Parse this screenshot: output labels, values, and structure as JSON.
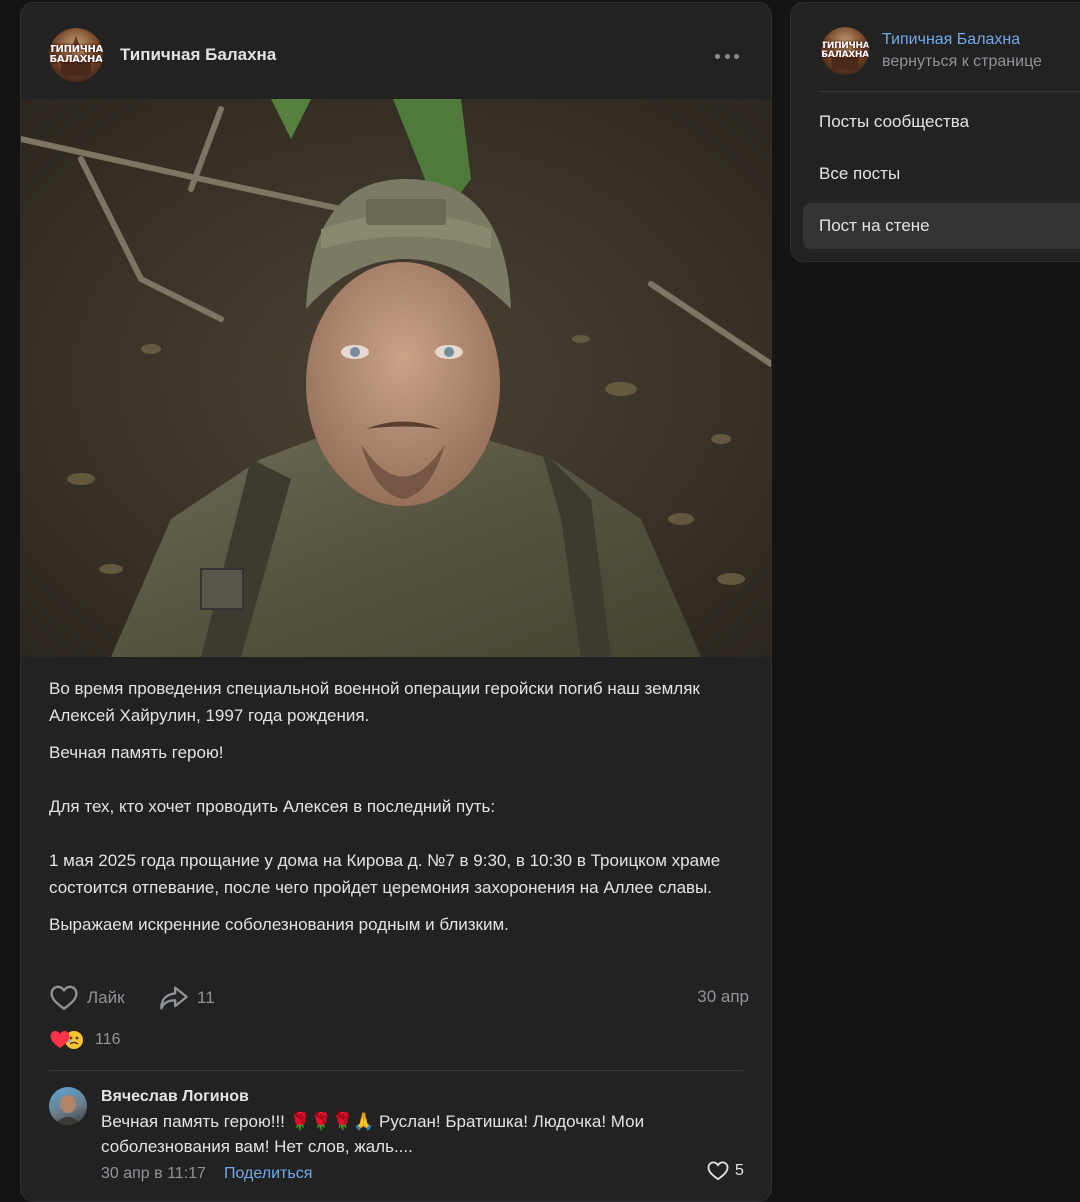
{
  "post": {
    "author": "Типичная Балахна",
    "avatar_text_line1": "ТИПИЧНАЯ",
    "avatar_text_line2": "БАЛАХНА",
    "paragraphs": [
      "Во время проведения специальной военной операции геройски погиб наш земляк Алексей Хайрулин, 1997 года рождения.",
      "Вечная память герою!",
      "Для тех, кто хочет проводить Алексея в последний путь:",
      "1 мая 2025 года прощание у дома на Кирова д. №7 в 9:30, в 10:30 в Троицком храме состоится отпевание, после чего пройдет церемония захоронения на Аллее славы.",
      "Выражаем искренние соболезнования родным и близким."
    ],
    "like_label": "Лайк",
    "share_count": "11",
    "date": "30 апр",
    "reactions_count": "116"
  },
  "comment": {
    "author": "Вячеслав Логинов",
    "text": "Вечная память герою!!! 🌹🌹🌹🙏 Руслан! Братишка! Людочка! Мои соболезнования вам! Нет слов, жаль....",
    "time": "30 апр в 11:17",
    "share_label": "Поделиться",
    "likes": "5"
  },
  "sidebar": {
    "title": "Типичная Балахна",
    "back_link": "вернуться к странице",
    "items": [
      {
        "label": "Посты сообщества",
        "active": false
      },
      {
        "label": "Все посты",
        "active": false
      },
      {
        "label": "Пост на стене",
        "active": true
      }
    ]
  },
  "colors": {
    "background": "#141414",
    "card": "#222222",
    "text": "#e1e3e6",
    "muted": "#909499",
    "link": "#71aaeb",
    "heart": "#ff3347"
  },
  "icons": [
    "more-icon",
    "heart-outline-icon",
    "share-arrow-icon",
    "heart-reaction-icon",
    "sad-reaction-icon",
    "small-heart-icon"
  ]
}
